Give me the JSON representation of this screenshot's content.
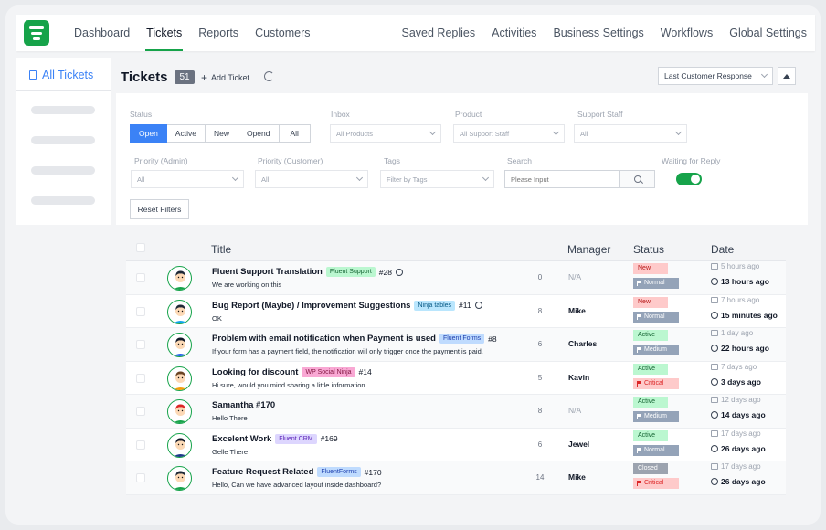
{
  "nav": {
    "left": [
      "Dashboard",
      "Tickets",
      "Reports",
      "Customers"
    ],
    "right": [
      "Saved Replies",
      "Activities",
      "Business Settings",
      "Workflows",
      "Global Settings"
    ]
  },
  "sidebar": {
    "title": "All Tickets"
  },
  "header": {
    "title": "Tickets",
    "count": "51",
    "add_label": "Add Ticket",
    "sort_value": "Last Customer Response"
  },
  "filters": {
    "status_label": "Status",
    "status_options": [
      "Open",
      "Active",
      "New",
      "Opend",
      "All"
    ],
    "status_selected": "Open",
    "inbox_label": "Inbox",
    "inbox_value": "All Products",
    "product_label": "Product",
    "product_value": "All Support Staff",
    "staff_label": "Support Staff",
    "staff_value": "All",
    "priority_admin_label": "Priority (Admin)",
    "priority_admin_value": "All",
    "priority_customer_label": "Priority (Customer)",
    "priority_customer_value": "All",
    "tags_label": "Tags",
    "tags_value": "Filter by Tags",
    "search_label": "Search",
    "search_placeholder": "Please Input",
    "waiting_label": "Waiting for Reply",
    "reset_label": "Reset Filters"
  },
  "table": {
    "headers": {
      "title": "Title",
      "manager": "Manager",
      "status": "Status",
      "date": "Date"
    },
    "rows": [
      {
        "title": "Fluent Support Translation",
        "tag": "Fluent Support",
        "tag_bg": "#bbf7d0",
        "tag_fg": "#166534",
        "num": "#28",
        "mini": true,
        "sub": "We are working on this",
        "count": "0",
        "manager": "N/A",
        "status": "New",
        "priority": "Normal",
        "ago": "5 hours ago",
        "date": "13 hours ago",
        "face": "#1f2937",
        "shirt": "#16a34a"
      },
      {
        "title": "Bug Report (Maybe) / Improvement Suggestions",
        "tag": "Ninja tables",
        "tag_bg": "#bae6fd",
        "tag_fg": "#075985",
        "num": "#11",
        "mini": true,
        "sub": "OK",
        "count": "8",
        "manager": "Mike",
        "status": "New",
        "priority": "Normal",
        "ago": "7 hours ago",
        "date": "15 minutes ago",
        "face": "#1f2937",
        "shirt": "#0ea5e9"
      },
      {
        "title": "Problem with email notification when Payment is used",
        "tag": "Fluent Forms",
        "tag_bg": "#bfdbfe",
        "tag_fg": "#1e40af",
        "num": "#8",
        "mini": false,
        "sub": "If your form has a payment field, the notification will only trigger once the payment is paid.",
        "count": "6",
        "manager": "Charles",
        "status": "Active",
        "priority": "Medium",
        "ago": "1 day ago",
        "date": "22 hours ago",
        "face": "#111827",
        "shirt": "#2563eb"
      },
      {
        "title": "Looking for discount",
        "tag": "WP Social Ninja",
        "tag_bg": "#f9a8d4",
        "tag_fg": "#831843",
        "num": "#14",
        "mini": false,
        "sub": "Hi sure, would you mind sharing a little information.",
        "count": "5",
        "manager": "Kavin",
        "status": "Active",
        "priority": "Critical",
        "ago": "7 days ago",
        "date": "3 days ago",
        "face": "#6b4423",
        "shirt": "#f59e0b"
      },
      {
        "title": "Samantha #170",
        "tag": "",
        "tag_bg": "",
        "tag_fg": "",
        "num": "",
        "mini": false,
        "sub": "Hello There",
        "count": "8",
        "manager": "N/A",
        "status": "Active",
        "priority": "Medium",
        "ago": "12 days ago",
        "date": "14 days ago",
        "face": "#dc2626",
        "shirt": "#16a34a"
      },
      {
        "title": "Excelent Work",
        "tag": "Fluent CRM",
        "tag_bg": "#ddd6fe",
        "tag_fg": "#5b21b6",
        "num": "#169",
        "mini": false,
        "sub": "Gelle There",
        "count": "6",
        "manager": "Jewel",
        "status": "Active",
        "priority": "Normal",
        "ago": "17 days ago",
        "date": "26 days ago",
        "face": "#111827",
        "shirt": "#1e3a8a"
      },
      {
        "title": "Feature Request Related",
        "tag": "FluentForms",
        "tag_bg": "#bfdbfe",
        "tag_fg": "#1e40af",
        "num": "#170",
        "mini": false,
        "sub": "Hello, Can we have advanced layout inside dashboard?",
        "count": "14",
        "manager": "Mike",
        "status": "Closed",
        "priority": "Critical",
        "ago": "17 days ago",
        "date": "26 days ago",
        "face": "#1f2937",
        "shirt": "#16a34a"
      }
    ]
  },
  "colors": {
    "brand": "#16a34a",
    "accent": "#3b82f6",
    "status_new_bg": "#fecaca",
    "status_new_fg": "#b91c1c",
    "status_active_bg": "#bbf7d0",
    "status_active_fg": "#166534",
    "status_closed_bg": "#9ca3af",
    "status_closed_fg": "#ffffff",
    "priority_normal_bg": "#94a3b8",
    "priority_medium_bg": "#94a3b8",
    "priority_critical_bg": "#fecaca",
    "priority_critical_fg": "#dc2626"
  },
  "icons": {
    "logo": "fluent-support-logo-icon",
    "sidebar": "document-icon",
    "add": "plus-icon",
    "refresh": "refresh-icon",
    "sort_dir": "triangle-up-icon",
    "search": "search-icon",
    "reply": "message-icon",
    "time": "clock-icon"
  }
}
